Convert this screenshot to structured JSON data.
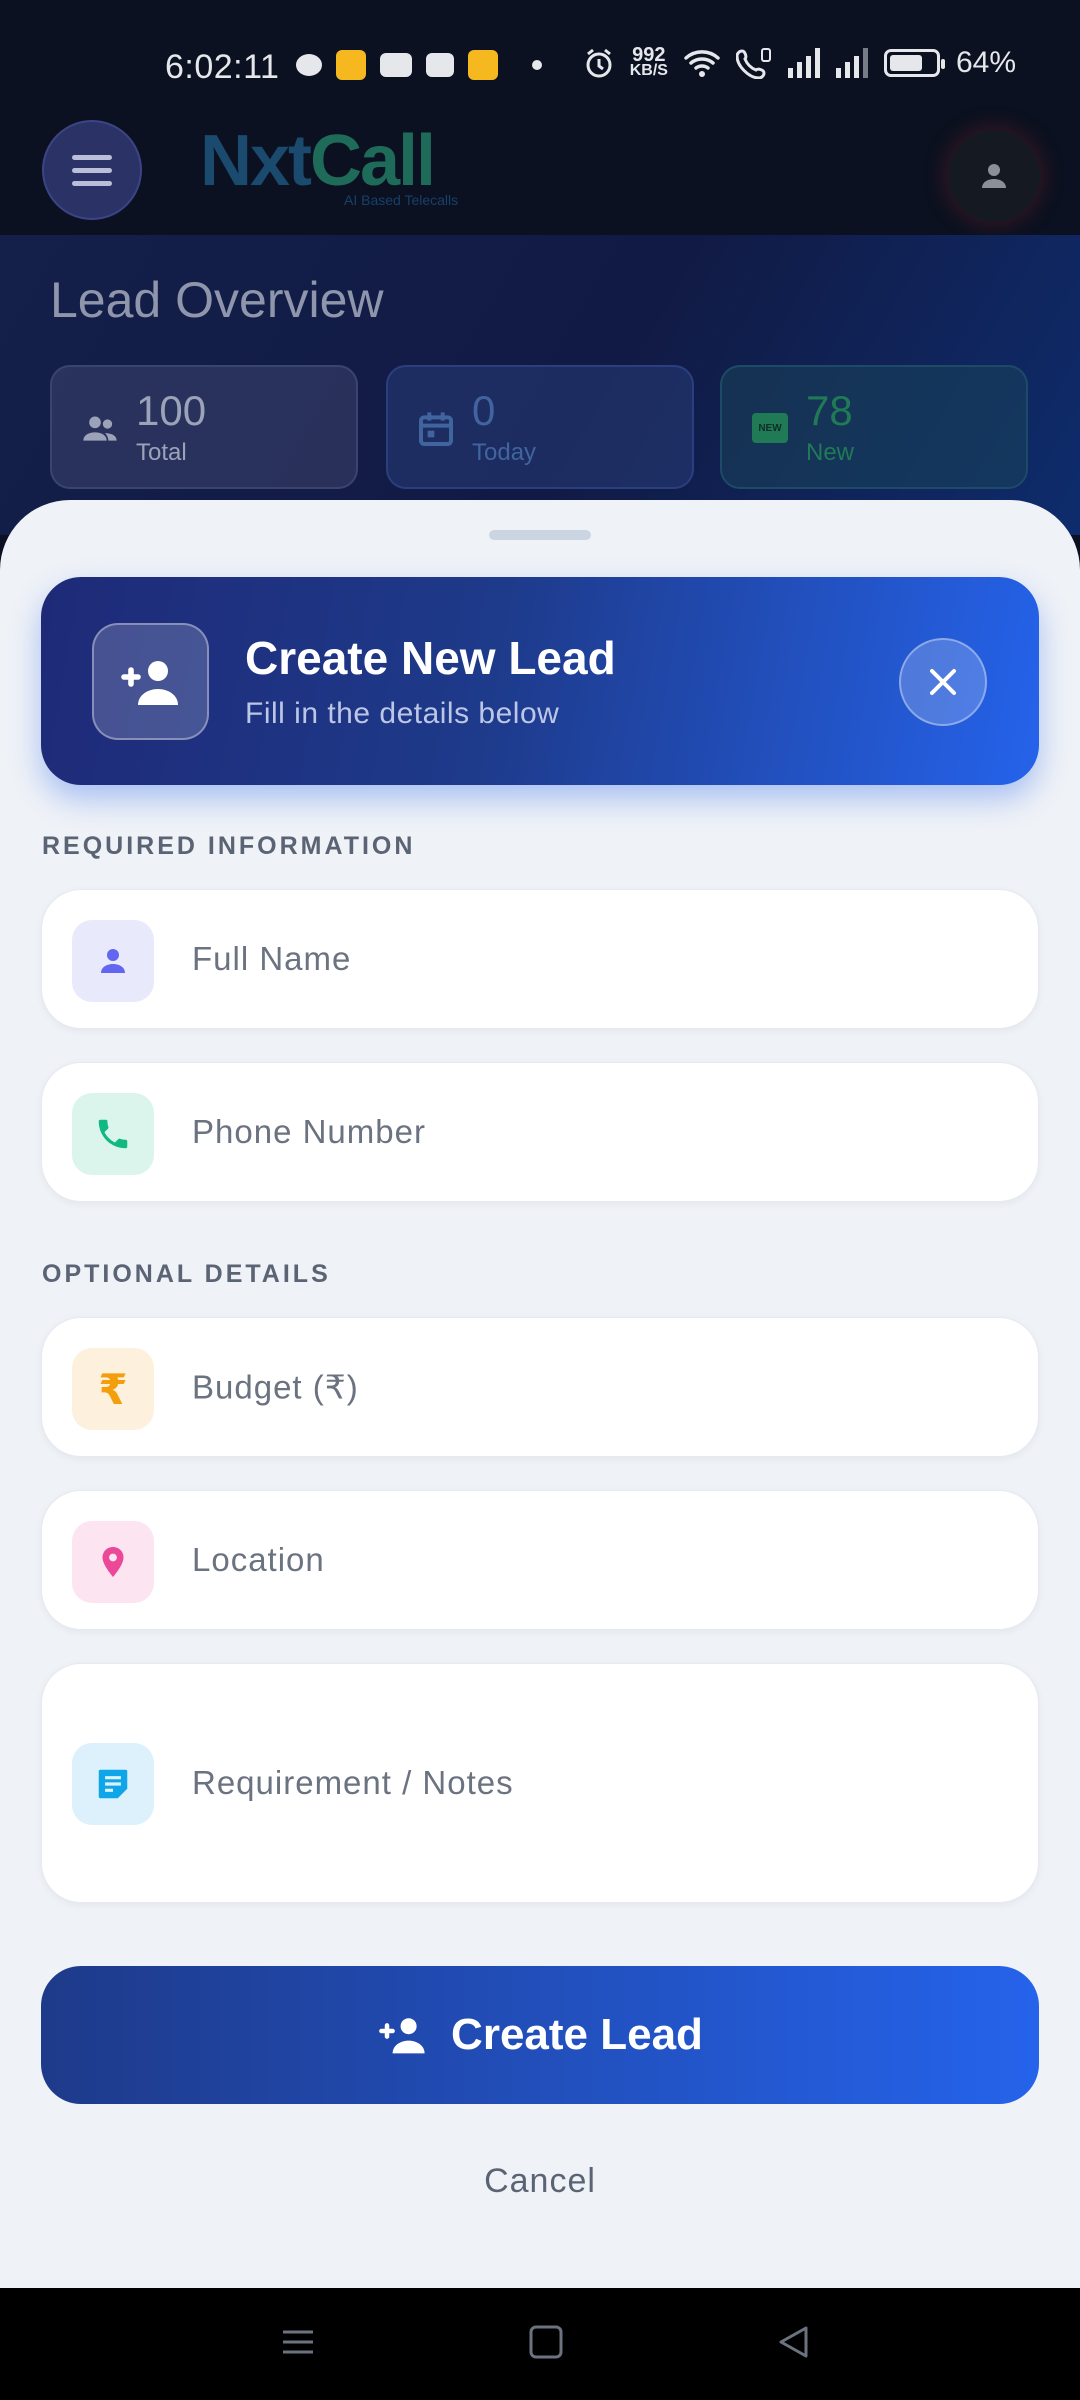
{
  "status_bar": {
    "time": "6:02:11",
    "net_speed_value": "992",
    "net_speed_unit": "KB/S",
    "battery": "64%",
    "battery_level": 0.64
  },
  "app_bar": {
    "logo_text_1": "Nxt",
    "logo_text_2": "Call",
    "logo_tagline": "AI Based Telecalls",
    "menu_icon": "hamburger-menu-icon",
    "profile_icon": "person-icon"
  },
  "overview": {
    "title": "Lead Overview",
    "stats": [
      {
        "value": "100",
        "label": "Total",
        "icon": "group-icon"
      },
      {
        "value": "0",
        "label": "Today",
        "icon": "calendar-icon"
      },
      {
        "value": "78",
        "label": "New",
        "icon": "new-badge-icon",
        "badge": "NEW"
      }
    ]
  },
  "sheet": {
    "header": {
      "title": "Create New Lead",
      "subtitle": "Fill in the details below",
      "icon": "person-add-icon",
      "close_icon": "close-icon"
    },
    "required_section_label": "REQUIRED INFORMATION",
    "optional_section_label": "OPTIONAL DETAILS",
    "fields": {
      "full_name": {
        "placeholder": "Full Name",
        "icon": "person-icon",
        "accent": "#6366f1"
      },
      "phone": {
        "placeholder": "Phone Number",
        "icon": "phone-icon",
        "accent": "#10b981"
      },
      "budget": {
        "placeholder": "Budget (₹)",
        "icon": "rupee-icon",
        "accent": "#f59e0b"
      },
      "location": {
        "placeholder": "Location",
        "icon": "location-pin-icon",
        "accent": "#ec4899"
      },
      "notes": {
        "placeholder": "Requirement / Notes",
        "icon": "notes-icon",
        "accent": "#0ea5e9"
      }
    },
    "submit_label": "Create Lead",
    "cancel_label": "Cancel"
  },
  "nav_bar": {
    "items": [
      "menu-icon",
      "home-icon",
      "back-icon"
    ]
  },
  "colors": {
    "primary_dark": "#1e3a8a",
    "primary": "#2563eb",
    "sheet_bg": "#eff2f7"
  }
}
